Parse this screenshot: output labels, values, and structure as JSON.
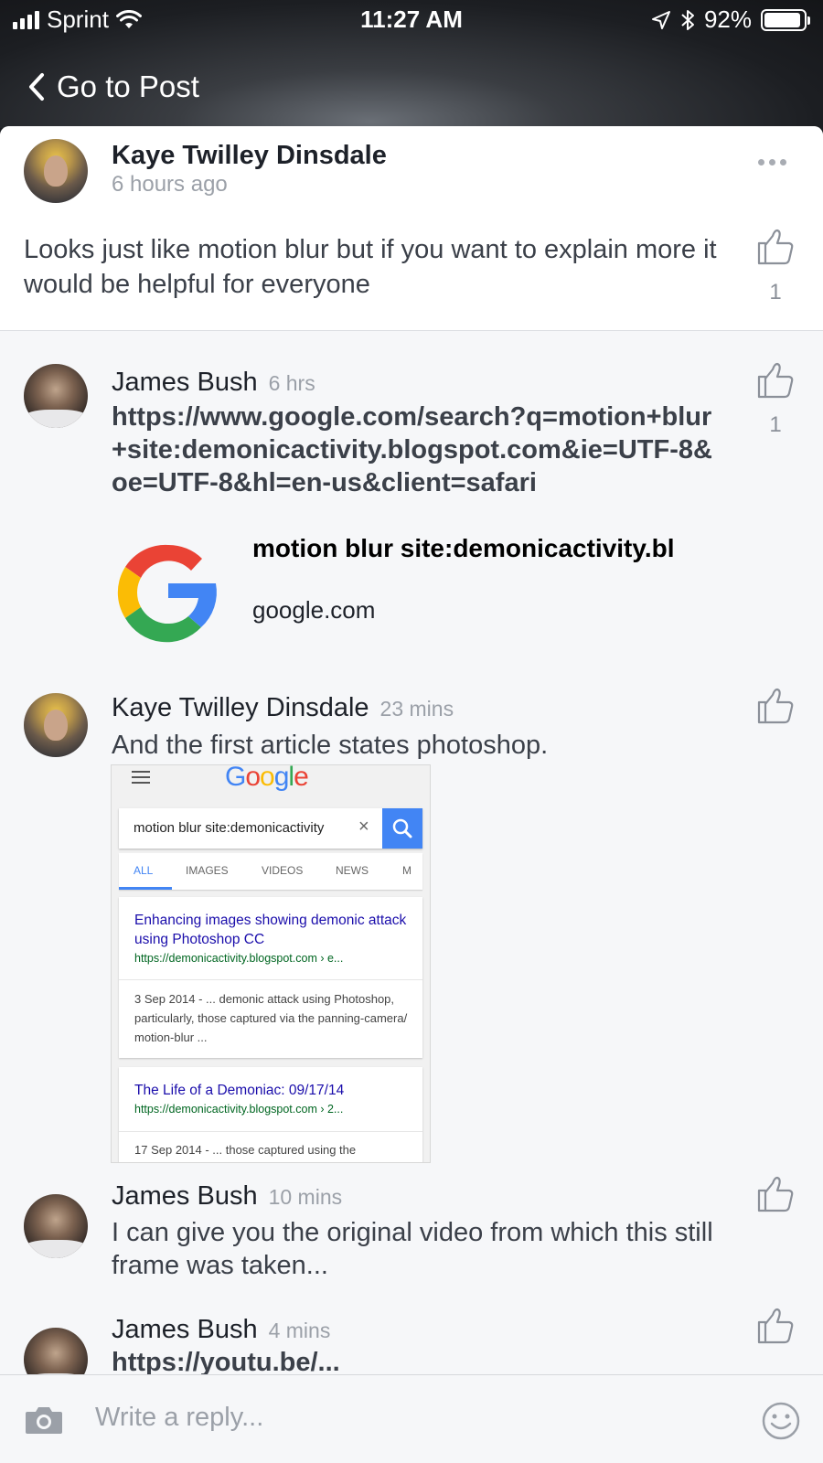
{
  "status_bar": {
    "carrier": "Sprint",
    "time": "11:27 AM",
    "battery": "92%",
    "battery_level": 0.92
  },
  "nav": {
    "back_label": "Go to Post"
  },
  "original_comment": {
    "author": "Kaye Twilley Dinsdale",
    "time": "6 hours ago",
    "text": "Looks just like motion blur but if you want to explain more it would be helpful for everyone",
    "likes": "1"
  },
  "replies": [
    {
      "author": "James Bush",
      "time": "6 hrs",
      "link": "https://www.google.com/search?q=motion+blur+site:demonicactivity.blogspot.com&ie=UTF-8&oe=UTF-8&hl=en-us&client=safari",
      "likes": "1",
      "preview": {
        "title": "motion blur site:demonicactivity.bl",
        "domain": "google.com"
      }
    },
    {
      "author": "Kaye Twilley Dinsdale",
      "time": "23 mins",
      "text": "And the first article states photoshop.",
      "screenshot": {
        "logo_text": "Google",
        "search_query": "motion blur site:demonicactivity",
        "clear_glyph": "×",
        "tabs": [
          "ALL",
          "IMAGES",
          "VIDEOS",
          "NEWS",
          "M"
        ],
        "results": [
          {
            "title": "Enhancing images showing demonic attack using Photoshop CC",
            "url": "https://demonicactivity.blogspot.com › e...",
            "snippet": "3 Sep 2014 - ... demonic attack using Photoshop, particularly, those captured via the panning-camera/ motion-blur ..."
          },
          {
            "title": "The Life of a Demoniac: 09/17/14",
            "url": "https://demonicactivity.blogspot.com › 2...",
            "snippet": "17 Sep 2014 - ... those captured using the"
          }
        ]
      }
    },
    {
      "author": "James Bush",
      "time": "10 mins",
      "text": "I can give you the original video from which this still frame was taken..."
    },
    {
      "author": "James Bush",
      "time": "4 mins",
      "text": "https://youtu.be/..."
    }
  ],
  "composer": {
    "placeholder": "Write a reply..."
  },
  "icons": [
    "signal-icon",
    "wifi-icon",
    "location-arrow-icon",
    "bluetooth-icon",
    "battery-icon",
    "chevron-left-icon",
    "more-icon",
    "thumbs-up-icon",
    "google-logo-icon",
    "hamburger-icon",
    "search-icon",
    "camera-icon",
    "smiley-icon"
  ]
}
